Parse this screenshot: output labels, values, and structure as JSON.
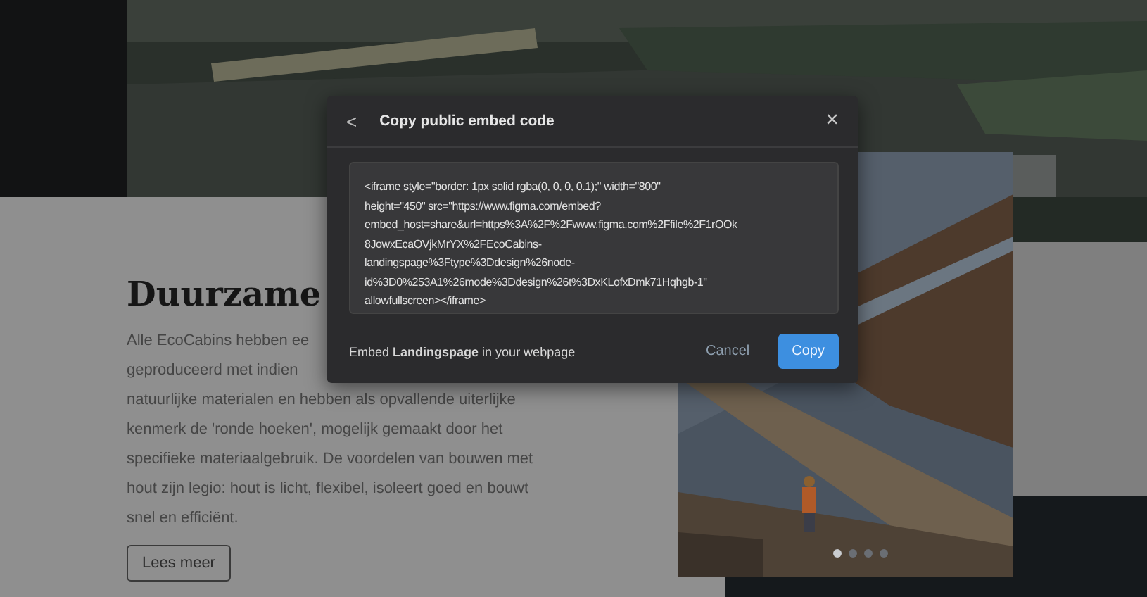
{
  "hero_section": {
    "heading": "Duurzame",
    "paragraph_lines": [
      "Alle EcoCabins hebben ee",
      "geproduceerd met indien",
      "natuurlijke materialen en hebben als opvallende uiterlijke",
      "kenmerk de 'ronde hoeken', mogelijk gemaakt door het",
      "specifieke materiaalgebruik. De voordelen van bouwen met",
      "hout zijn legio: hout is licht, flexibel, isoleert goed en bouwt",
      "snel en efficiënt."
    ],
    "button": "Lees meer",
    "carousel_dots": [
      {
        "selected": true
      },
      {
        "selected": false
      },
      {
        "selected": false
      },
      {
        "selected": false
      }
    ]
  },
  "dialog": {
    "back": "<",
    "title": "Copy public embed code",
    "close": "×",
    "code": "<iframe style=\"border: 1px solid rgba(0, 0, 0, 0.1);\" width=\"800\"\nheight=\"450\" src=\"https://www.figma.com/embed?\nembed_host=share&url=https%3A%2F%2Fwww.figma.com%2Ffile%2F1rOOk\n8JowxEcaOVjkMrYX%2FEcoCabins-\nlandingspage%3Ftype%3Ddesign%26node-\nid%3D0%253A1%26mode%3Ddesign%26t%3DxKLofxDmk71Hqhgb-1\"\nallowfullscreen></iframe>",
    "footer": "Embed **Landingspage** in your webpage",
    "buttons": [
      {
        "label": "Cancel",
        "kind": "secondary"
      },
      {
        "label": "Copy",
        "kind": "primary"
      }
    ]
  }
}
